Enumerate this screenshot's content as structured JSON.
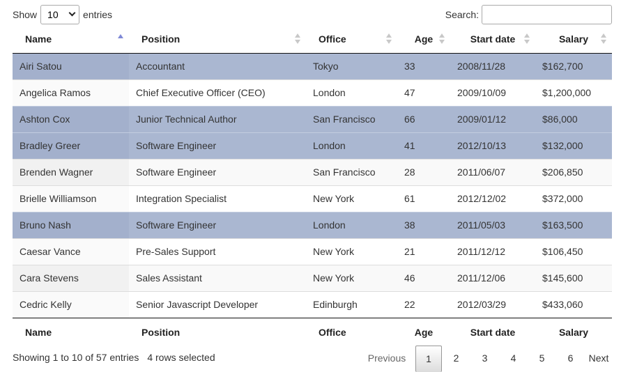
{
  "length": {
    "show_label": "Show",
    "value": "10",
    "entries_label": "entries"
  },
  "search": {
    "label": "Search:",
    "value": ""
  },
  "columns": [
    "Name",
    "Position",
    "Office",
    "Age",
    "Start date",
    "Salary"
  ],
  "sorted_column": "Name",
  "sort_direction": "asc",
  "rows": [
    {
      "name": "Airi Satou",
      "position": "Accountant",
      "office": "Tokyo",
      "age": "33",
      "start": "2008/11/28",
      "salary": "$162,700",
      "selected": true
    },
    {
      "name": "Angelica Ramos",
      "position": "Chief Executive Officer (CEO)",
      "office": "London",
      "age": "47",
      "start": "2009/10/09",
      "salary": "$1,200,000",
      "selected": false
    },
    {
      "name": "Ashton Cox",
      "position": "Junior Technical Author",
      "office": "San Francisco",
      "age": "66",
      "start": "2009/01/12",
      "salary": "$86,000",
      "selected": true
    },
    {
      "name": "Bradley Greer",
      "position": "Software Engineer",
      "office": "London",
      "age": "41",
      "start": "2012/10/13",
      "salary": "$132,000",
      "selected": true
    },
    {
      "name": "Brenden Wagner",
      "position": "Software Engineer",
      "office": "San Francisco",
      "age": "28",
      "start": "2011/06/07",
      "salary": "$206,850",
      "selected": false
    },
    {
      "name": "Brielle Williamson",
      "position": "Integration Specialist",
      "office": "New York",
      "age": "61",
      "start": "2012/12/02",
      "salary": "$372,000",
      "selected": false
    },
    {
      "name": "Bruno Nash",
      "position": "Software Engineer",
      "office": "London",
      "age": "38",
      "start": "2011/05/03",
      "salary": "$163,500",
      "selected": true
    },
    {
      "name": "Caesar Vance",
      "position": "Pre-Sales Support",
      "office": "New York",
      "age": "21",
      "start": "2011/12/12",
      "salary": "$106,450",
      "selected": false
    },
    {
      "name": "Cara Stevens",
      "position": "Sales Assistant",
      "office": "New York",
      "age": "46",
      "start": "2011/12/06",
      "salary": "$145,600",
      "selected": false
    },
    {
      "name": "Cedric Kelly",
      "position": "Senior Javascript Developer",
      "office": "Edinburgh",
      "age": "22",
      "start": "2012/03/29",
      "salary": "$433,060",
      "selected": false
    }
  ],
  "info": {
    "text": "Showing 1 to 10 of 57 entries",
    "selected_text": "4 rows selected"
  },
  "pagination": {
    "previous": "Previous",
    "pages": [
      "1",
      "2",
      "3",
      "4",
      "5",
      "6"
    ],
    "current": "1",
    "next": "Next"
  },
  "colors": {
    "selected_row": "#aab7d1",
    "sort_active": "#7f89d6",
    "header_rule": "#111111"
  }
}
